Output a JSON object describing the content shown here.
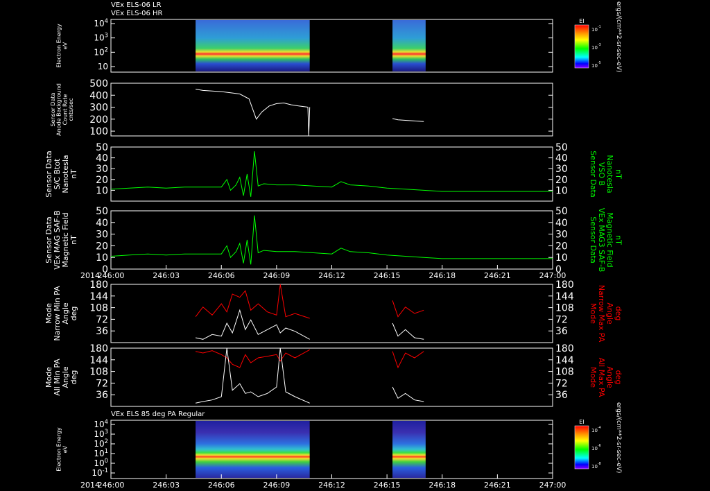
{
  "header": {
    "line1": "VEx ELS-06 LR",
    "line2": "VEx ELS-06 HR",
    "bottom_title": "VEx ELS 85 deg PA Regular"
  },
  "colors": {
    "background": "#000000",
    "axes": "#ffffff",
    "white_trace": "#ffffff",
    "green_trace": "#00ff00",
    "red_trace": "#ff0000"
  },
  "time_axis": {
    "start_label": "2014",
    "ticks": [
      "246:00",
      "246:03",
      "246:06",
      "246:09",
      "246:12",
      "246:15",
      "246:18",
      "246:21",
      "247:00"
    ]
  },
  "chart_data": [
    {
      "type": "heatmap",
      "id": "spectrogram-top",
      "ylabel": "Electron Energy\neV",
      "yticks": [
        "10",
        "10^2",
        "10^3",
        "10^4"
      ],
      "colorbar": {
        "label": "EI",
        "ticks": [
          "10^-1",
          "10^-3",
          "10^-5"
        ],
        "unit": "ergs/(cm**2-sr-sec-eV)"
      },
      "data_intervals": [
        [
          "246:04.6",
          "246:10.8"
        ],
        [
          "246:15.3",
          "246:17.1"
        ]
      ]
    },
    {
      "type": "line",
      "id": "count-rate",
      "ylabel": "Sensor Data\nAnode Background\nCount Rate\ncnts/sec",
      "ylim": [
        60,
        500
      ],
      "yticks": [
        "100",
        "200",
        "300",
        "400",
        "500"
      ],
      "color": "#ffffff",
      "series": [
        {
          "x": [
            4.6,
            5.0,
            5.5,
            6.0,
            6.5,
            7.0,
            7.5,
            7.9,
            8.2,
            8.6,
            9.0,
            9.4,
            9.8,
            10.2,
            10.7,
            10.75,
            10.8
          ],
          "y": [
            450,
            440,
            435,
            430,
            420,
            410,
            370,
            200,
            260,
            310,
            330,
            335,
            320,
            310,
            300,
            50,
            300
          ]
        },
        {
          "x": [
            15.3,
            15.6,
            16.0,
            16.5,
            17.0
          ],
          "y": [
            205,
            195,
            190,
            185,
            180
          ]
        }
      ]
    },
    {
      "type": "line",
      "id": "bmag-vso",
      "ylabel": "Sensor Data\nS/C Btot\nNanotesla\nnT",
      "right_label": "Sensor Data\nVSO B\nNanotesla\nnT",
      "ylim": [
        0,
        50
      ],
      "yticks": [
        "10",
        "20",
        "30",
        "40",
        "50"
      ],
      "color": "#00ff00",
      "series": [
        {
          "x": [
            0,
            1,
            2,
            3,
            4,
            5,
            6,
            6.3,
            6.5,
            6.8,
            7.0,
            7.2,
            7.4,
            7.6,
            7.8,
            8.0,
            8.3,
            9,
            10,
            11,
            12,
            12.5,
            13,
            14,
            15,
            16,
            17,
            18,
            19,
            20,
            21,
            22,
            23,
            24
          ],
          "y": [
            11,
            12,
            13,
            12,
            13,
            13,
            13,
            20,
            10,
            15,
            22,
            5,
            25,
            4,
            46,
            14,
            16,
            15,
            15,
            14,
            13,
            18,
            15,
            14,
            12,
            11,
            10,
            9,
            9,
            9,
            9,
            9,
            9,
            9
          ]
        }
      ]
    },
    {
      "type": "line",
      "id": "bmag-saf",
      "ylabel": "Sensor Data\nVEx MAG SAF-B\nMagnetic Field\nnT",
      "right_label": "Sensor Data\nVEx MAG3 SAF-B\nMagnetic Field\nnT",
      "ylim": [
        0,
        50
      ],
      "yticks": [
        "0",
        "10",
        "20",
        "30",
        "40",
        "50"
      ],
      "color": "#00ff00",
      "series": [
        {
          "x": [
            0,
            1,
            2,
            3,
            4,
            5,
            6,
            6.3,
            6.5,
            6.8,
            7.0,
            7.2,
            7.4,
            7.6,
            7.8,
            8.0,
            8.3,
            9,
            10,
            11,
            12,
            12.5,
            13,
            14,
            15,
            16,
            17,
            18,
            19,
            20,
            21,
            22,
            23,
            24
          ],
          "y": [
            11,
            12,
            13,
            12,
            13,
            13,
            13,
            20,
            10,
            15,
            22,
            5,
            25,
            4,
            46,
            14,
            16,
            15,
            15,
            14,
            13,
            18,
            15,
            14,
            12,
            11,
            10,
            9,
            9,
            9,
            9,
            9,
            9,
            9
          ]
        }
      ]
    },
    {
      "type": "line",
      "id": "pa-narrow",
      "ylabel": "Mode\nNarrow Min PA\nAngle\ndeg",
      "right_label": "Mode\nNarrow Max PA\nAngle\ndeg",
      "ylim": [
        0,
        180
      ],
      "yticks": [
        "36",
        "72",
        "108",
        "144",
        "180"
      ],
      "series": [
        {
          "name": "",
          "color": "#ff0000",
          "x": [
            4.6,
            5.0,
            5.5,
            6.0,
            6.3,
            6.6,
            7.0,
            7.3,
            7.6,
            8.0,
            8.5,
            9.0,
            9.2,
            9.5,
            10.0,
            10.8
          ],
          "y": [
            80,
            110,
            85,
            120,
            95,
            150,
            140,
            160,
            100,
            120,
            95,
            85,
            180,
            80,
            90,
            75
          ]
        },
        {
          "name": "",
          "color": "#ff0000",
          "x": [
            15.3,
            15.6,
            16.0,
            16.5,
            17.0
          ],
          "y": [
            130,
            80,
            110,
            90,
            100
          ]
        },
        {
          "name": "",
          "color": "#ffffff",
          "x": [
            4.6,
            5.0,
            5.5,
            6.0,
            6.3,
            6.6,
            7.0,
            7.3,
            7.6,
            8.0,
            8.5,
            9.0,
            9.2,
            9.5,
            10.0,
            10.8
          ],
          "y": [
            15,
            10,
            25,
            20,
            60,
            30,
            100,
            40,
            70,
            25,
            40,
            55,
            30,
            45,
            35,
            10
          ]
        },
        {
          "name": "",
          "color": "#ffffff",
          "x": [
            15.3,
            15.6,
            16.0,
            16.5,
            17.0
          ],
          "y": [
            60,
            20,
            40,
            15,
            10
          ]
        }
      ]
    },
    {
      "type": "line",
      "id": "pa-all",
      "ylabel": "Mode\nAll Min PA\nAngle\ndeg",
      "right_label": "Mode\nAll Max PA\nAngle\ndeg",
      "ylim": [
        0,
        180
      ],
      "yticks": [
        "36",
        "72",
        "108",
        "144",
        "180"
      ],
      "series": [
        {
          "name": "",
          "color": "#ff0000",
          "x": [
            4.6,
            5.0,
            5.5,
            6.0,
            6.3,
            6.6,
            7.0,
            7.3,
            7.6,
            8.0,
            8.5,
            9.0,
            9.2,
            9.5,
            10.0,
            10.8
          ],
          "y": [
            170,
            165,
            172,
            160,
            150,
            130,
            120,
            160,
            135,
            150,
            155,
            160,
            140,
            165,
            150,
            175
          ]
        },
        {
          "name": "",
          "color": "#ff0000",
          "x": [
            15.3,
            15.6,
            16.0,
            16.5,
            17.0
          ],
          "y": [
            170,
            120,
            165,
            150,
            170
          ]
        },
        {
          "name": "",
          "color": "#ffffff",
          "x": [
            4.6,
            5.0,
            5.5,
            6.0,
            6.3,
            6.6,
            7.0,
            7.3,
            7.6,
            8.0,
            8.5,
            9.0,
            9.2,
            9.5,
            10.0,
            10.8
          ],
          "y": [
            10,
            15,
            20,
            30,
            180,
            50,
            70,
            40,
            45,
            30,
            40,
            60,
            180,
            45,
            30,
            10
          ]
        },
        {
          "name": "",
          "color": "#ffffff",
          "x": [
            15.3,
            15.6,
            16.0,
            16.5,
            17.0
          ],
          "y": [
            60,
            25,
            40,
            20,
            15
          ]
        }
      ]
    },
    {
      "type": "heatmap",
      "id": "spectrogram-bottom",
      "ylabel": "Electron Energy\neV",
      "yticks": [
        "10^-1",
        "10^0",
        "10^1",
        "10^2",
        "10^3",
        "10^4"
      ],
      "colorbar": {
        "label": "EI",
        "ticks": [
          "10^-4",
          "10^-6",
          "10^-8"
        ],
        "unit": "ergs/(cm**2-sr-sec-eV)"
      },
      "data_intervals": [
        [
          "246:04.6",
          "246:10.8"
        ],
        [
          "246:15.3",
          "246:17.1"
        ]
      ]
    }
  ]
}
